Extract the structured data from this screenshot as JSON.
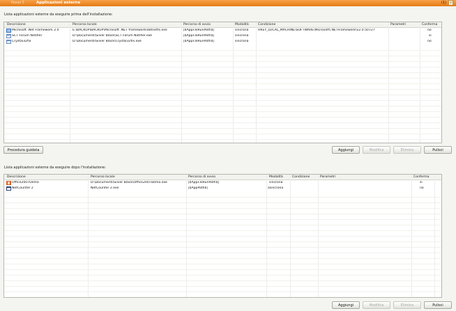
{
  "titlebar": {
    "step": "Passo 5",
    "title": "Applicazioni esterne",
    "hint": "(1)",
    "help": "?"
  },
  "top_section": {
    "label": "Lista applicazioni esterne da eseguire prima dell'installazione:",
    "columns": [
      "Descrizione",
      "Percorso locale",
      "Percorso di avvio",
      "Modalità",
      "Condizione",
      "Parametri",
      "Conferma"
    ],
    "rows": [
      {
        "icon": "dotnet-icon",
        "desc": "Microsoft .Net Framework 2.0",
        "local": "E:\\BACKUP\\BACKUP\\Microsoft .NET framework\\dotnetfx.exe",
        "start": "|$AppsToRunPath$|",
        "mode": "sincrona",
        "cond": "HKEY_LOCAL_MACHINE\\SOFTWARE\\Microsoft\\.NETFramework\\v2.0.50727",
        "params": "",
        "confirm": "no"
      },
      {
        "icon": "app-icon",
        "desc": "SCT Forum Notifier",
        "local": "D:\\Documenti\\Silver Black\\SCT Forum Notifier.exe",
        "start": "|$AppsToRunPath$|",
        "mode": "sincrona",
        "cond": "",
        "params": "",
        "confirm": "sì"
      },
      {
        "icon": "app-icon",
        "desc": "Crystal32fix",
        "local": "D:\\Documenti\\Silver Black\\Crystal32fix.exe",
        "start": "|$AppsToRunPath$|",
        "mode": "sincrona",
        "cond": "",
        "params": "",
        "confirm": "no"
      }
    ],
    "wizard_button": "Procedura guidata",
    "buttons": {
      "add": "Aggiungi",
      "edit": "Modifica",
      "delete": "Elimina",
      "clear": "Pulisci"
    }
  },
  "bottom_section": {
    "label": "Lista applicazioni esterne da eseguire dopo l'installazione:",
    "columns": [
      "Descrizione",
      "Percorso locale",
      "Percorso di avvio",
      "Modalità",
      "Condizione",
      "Parametri",
      "Conferma"
    ],
    "rows": [
      {
        "icon": "office-icon",
        "desc": "Office2007Demo",
        "local": "D:\\Documenti\\Silver Black\\Office2007Demo.exe",
        "start": "|$AppsToRunPath$|",
        "mode": "sincrona",
        "cond": "",
        "params": "",
        "confirm": "sì"
      },
      {
        "icon": "window-icon",
        "desc": "NetCounter 2",
        "local": "NetCounter 2.exe",
        "start": "|$AppPath$|",
        "mode": "asincrona",
        "cond": "",
        "params": "",
        "confirm": "no"
      }
    ],
    "buttons": {
      "add": "Aggiungi",
      "edit": "Modifica",
      "delete": "Elimina",
      "clear": "Pulisci"
    }
  }
}
